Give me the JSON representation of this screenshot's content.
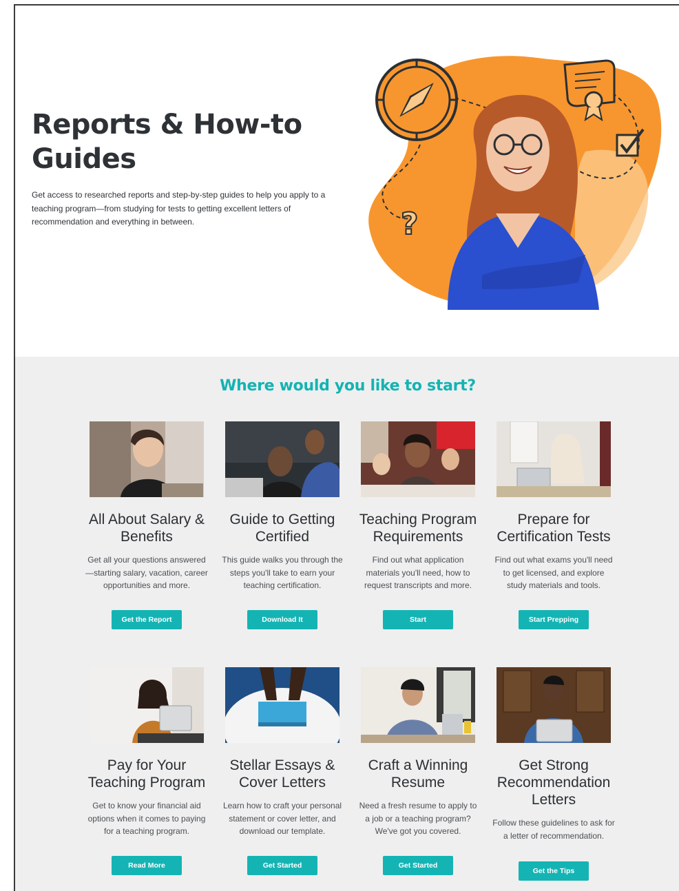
{
  "hero": {
    "title_line1": "Reports & How-to",
    "title_line2": "Guides",
    "description": "Get access to researched reports and step-by-step guides to help you apply to a teaching program—from studying for tests to getting excellent letters of recommendation and everything in between.",
    "colors": {
      "blob": "#f7962e",
      "blob_light": "#fbc98a",
      "shirt": "#2a4fcf",
      "hair": "#b75a2a"
    },
    "icons": [
      "compass-icon",
      "certificate-icon",
      "checkbox-icon",
      "question-mark-icon"
    ]
  },
  "section": {
    "heading": "Where would you like to start?",
    "accent": "#15b4b4"
  },
  "cards": [
    {
      "title": "All About Salary & Benefits",
      "description": "Get all your questions answered—starting salary, vacation, career opportunities and more.",
      "button": "Get the Report"
    },
    {
      "title": "Guide to Getting Certified",
      "description": "This guide walks you through the steps you'll take to earn your teaching certification.",
      "button": "Download It"
    },
    {
      "title": "Teaching Program Requirements",
      "description": "Find out what application materials you'll need, how to request transcripts and more.",
      "button": "Start"
    },
    {
      "title": "Prepare for Certification Tests",
      "description": "Find out what exams you'll need to get licensed, and explore study materials and tools.",
      "button": "Start Prepping"
    },
    {
      "title": "Pay for Your Teaching Program",
      "description": "Get to know your financial aid options when it comes to paying for a teaching program.",
      "button": "Read More"
    },
    {
      "title": "Stellar Essays & Cover Letters",
      "description": "Learn how to craft your personal statement or cover letter, and download our template.",
      "button": "Get Started"
    },
    {
      "title": "Craft a Winning Resume",
      "description": "Need a fresh resume to apply to a job or a teaching program? We've got you covered.",
      "button": "Get Started"
    },
    {
      "title": "Get Strong Recommendation Letters",
      "description": "Follow these guidelines to ask for a letter of recommendation.",
      "button": "Get the Tips"
    }
  ]
}
